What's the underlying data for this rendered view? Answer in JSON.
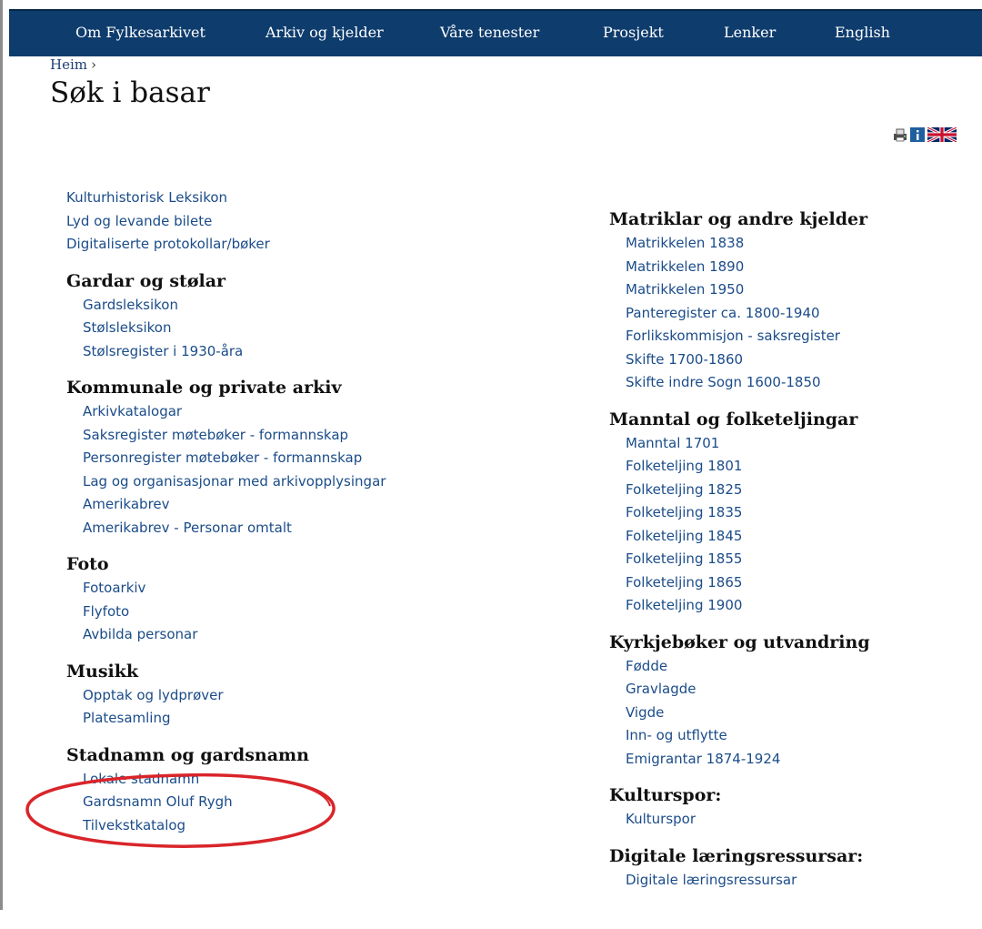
{
  "nav": {
    "items": [
      "Om Fylkesarkivet",
      "Arkiv og kjelder",
      "Våre tenester",
      "Prosjekt",
      "Lenker",
      "English"
    ],
    "background": "#0e3c6d"
  },
  "breadcrumb": {
    "home": "Heim",
    "separator": "›"
  },
  "page_title": "Søk i basar",
  "tools": {
    "icons": [
      "print-icon",
      "info-icon",
      "uk-flag-icon"
    ]
  },
  "left_column": {
    "top_links": [
      "Kulturhistorisk Leksikon",
      "Lyd og levande bilete",
      "Digitaliserte protokollar/bøker"
    ],
    "sections": [
      {
        "heading": "Gardar og stølar",
        "links": [
          "Gardsleksikon",
          "Stølsleksikon",
          "Stølsregister i 1930-åra"
        ]
      },
      {
        "heading": "Kommunale og private arkiv",
        "links": [
          "Arkivkatalogar",
          "Saksregister møtebøker - formannskap",
          "Personregister møtebøker - formannskap",
          "Lag og organisasjonar med arkivopplysingar",
          "Amerikabrev",
          "Amerikabrev - Personar omtalt"
        ]
      },
      {
        "heading": "Foto",
        "links": [
          "Fotoarkiv",
          "Flyfoto",
          "Avbilda personar"
        ]
      },
      {
        "heading": "Musikk",
        "links": [
          "Opptak og lydprøver",
          "Platesamling"
        ]
      },
      {
        "heading": "Stadnamn og gardsnamn",
        "links": [
          "Lokale stadnamn",
          "Gardsnamn Oluf Rygh",
          "Tilvekstkatalog"
        ]
      }
    ]
  },
  "right_column": {
    "sections": [
      {
        "heading": "Matriklar og andre kjelder",
        "links": [
          "Matrikkelen 1838",
          "Matrikkelen 1890",
          "Matrikkelen 1950",
          "Panteregister ca. 1800-1940",
          "Forlikskommisjon - saksregister",
          "Skifte 1700-1860",
          "Skifte indre Sogn 1600-1850"
        ]
      },
      {
        "heading": "Manntal og folketeljingar",
        "links": [
          "Manntal 1701",
          "Folketeljing 1801",
          "Folketeljing 1825",
          "Folketeljing 1835",
          "Folketeljing 1845",
          "Folketeljing 1855",
          "Folketeljing 1865",
          "Folketeljing 1900"
        ]
      },
      {
        "heading": "Kyrkjebøker og utvandring",
        "links": [
          "Fødde",
          "Gravlagde",
          "Vigde",
          "Inn- og utflytte",
          "Emigrantar 1874-1924"
        ]
      },
      {
        "heading": "Kulturspor:",
        "links": [
          "Kulturspor"
        ]
      },
      {
        "heading": "Digitale læringsressursar:",
        "links": [
          "Digitale læringsressursar"
        ]
      }
    ]
  },
  "colors": {
    "link": "#1b4c89",
    "heading": "#111111",
    "annotation": "#d9252a"
  }
}
